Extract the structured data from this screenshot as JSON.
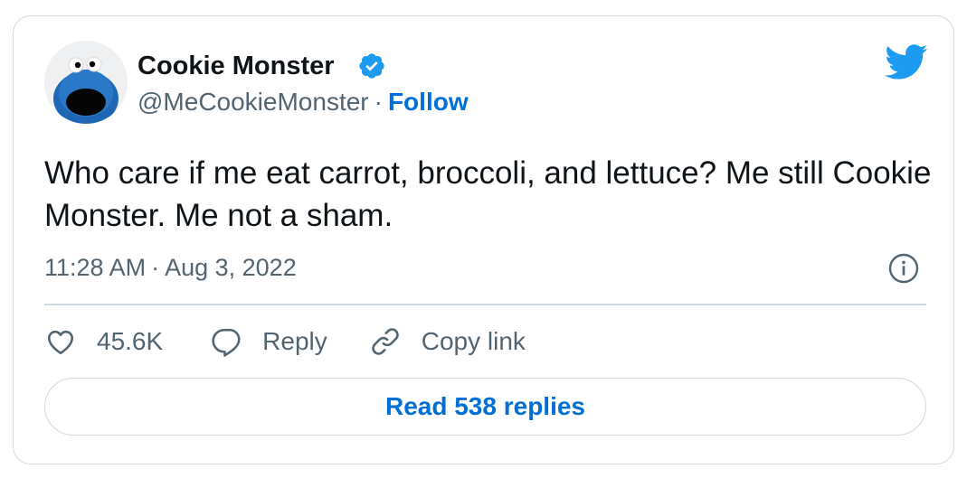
{
  "author": {
    "name": "Cookie Monster",
    "handle": "@MeCookieMonster",
    "separator": "·",
    "follow_label": "Follow",
    "verified": true,
    "avatar_icon": "cookie-monster-avatar"
  },
  "brand": {
    "icon": "twitter-bird-icon",
    "color": "#1d9bf0"
  },
  "tweet": {
    "text": "Who care if me eat carrot, broccoli, and lettuce? Me still Cookie Monster. Me not a sham.",
    "time": "11:28 AM",
    "separator": "·",
    "date": "Aug 3, 2022"
  },
  "actions": {
    "like_count": "45.6K",
    "reply_label": "Reply",
    "copy_label": "Copy link"
  },
  "read_replies_label": "Read 538 replies",
  "colors": {
    "link": "#006fd6",
    "secondary_text": "#536471",
    "border": "#cfd9de",
    "verified_badge": "#1d9bf0"
  }
}
